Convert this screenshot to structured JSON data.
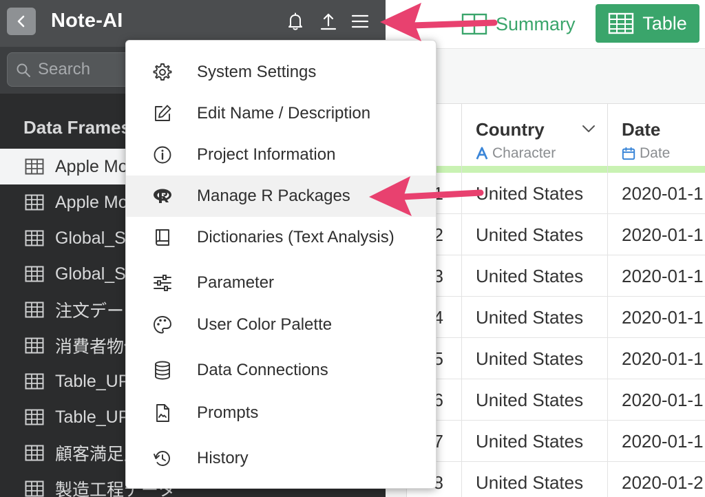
{
  "header": {
    "title": "Note-AI"
  },
  "search": {
    "placeholder": "Search"
  },
  "sidebar": {
    "section_title": "Data Frames",
    "items": [
      {
        "label": "Apple Mobility",
        "active": true
      },
      {
        "label": "Apple Mobility"
      },
      {
        "label": "Global_Sales"
      },
      {
        "label": "Global_Sales"
      },
      {
        "label": "注文データ"
      },
      {
        "label": "消費者物価"
      },
      {
        "label": "Table_UP"
      },
      {
        "label": "Table_UP"
      },
      {
        "label": "顧客満足度"
      },
      {
        "label": "製造工程データ"
      }
    ]
  },
  "toolbar": {
    "summary_label": "Summary",
    "table_label": "Table"
  },
  "table": {
    "columns": [
      {
        "name": "Country",
        "type": "Character"
      },
      {
        "name": "Date",
        "type": "Date"
      }
    ],
    "rows": [
      {
        "num": "1",
        "country": "United States",
        "date": "2020-01-1"
      },
      {
        "num": "2",
        "country": "United States",
        "date": "2020-01-1"
      },
      {
        "num": "3",
        "country": "United States",
        "date": "2020-01-1"
      },
      {
        "num": "4",
        "country": "United States",
        "date": "2020-01-1"
      },
      {
        "num": "5",
        "country": "United States",
        "date": "2020-01-1"
      },
      {
        "num": "6",
        "country": "United States",
        "date": "2020-01-1"
      },
      {
        "num": "7",
        "country": "United States",
        "date": "2020-01-1"
      },
      {
        "num": "8",
        "country": "United States",
        "date": "2020-01-2"
      }
    ]
  },
  "menu": {
    "items": [
      {
        "label": "System Settings",
        "icon": "gear-icon"
      },
      {
        "label": "Edit Name / Description",
        "icon": "edit-icon"
      },
      {
        "label": "Project Information",
        "icon": "info-icon"
      },
      {
        "label": "Manage R Packages",
        "icon": "r-logo-icon",
        "highlighted": true
      },
      {
        "label": "Dictionaries (Text Analysis)",
        "icon": "book-icon"
      },
      {
        "label": "Parameter",
        "icon": "sliders-icon"
      },
      {
        "label": "User Color Palette",
        "icon": "palette-icon"
      },
      {
        "label": "Data Connections",
        "icon": "database-icon"
      },
      {
        "label": "Prompts",
        "icon": "document-icon"
      },
      {
        "label": "History",
        "icon": "history-icon"
      }
    ]
  },
  "colors": {
    "accent_green": "#3aa56b",
    "arrow_pink": "#e8416f",
    "sidebar_bg": "#2b2c2d"
  }
}
